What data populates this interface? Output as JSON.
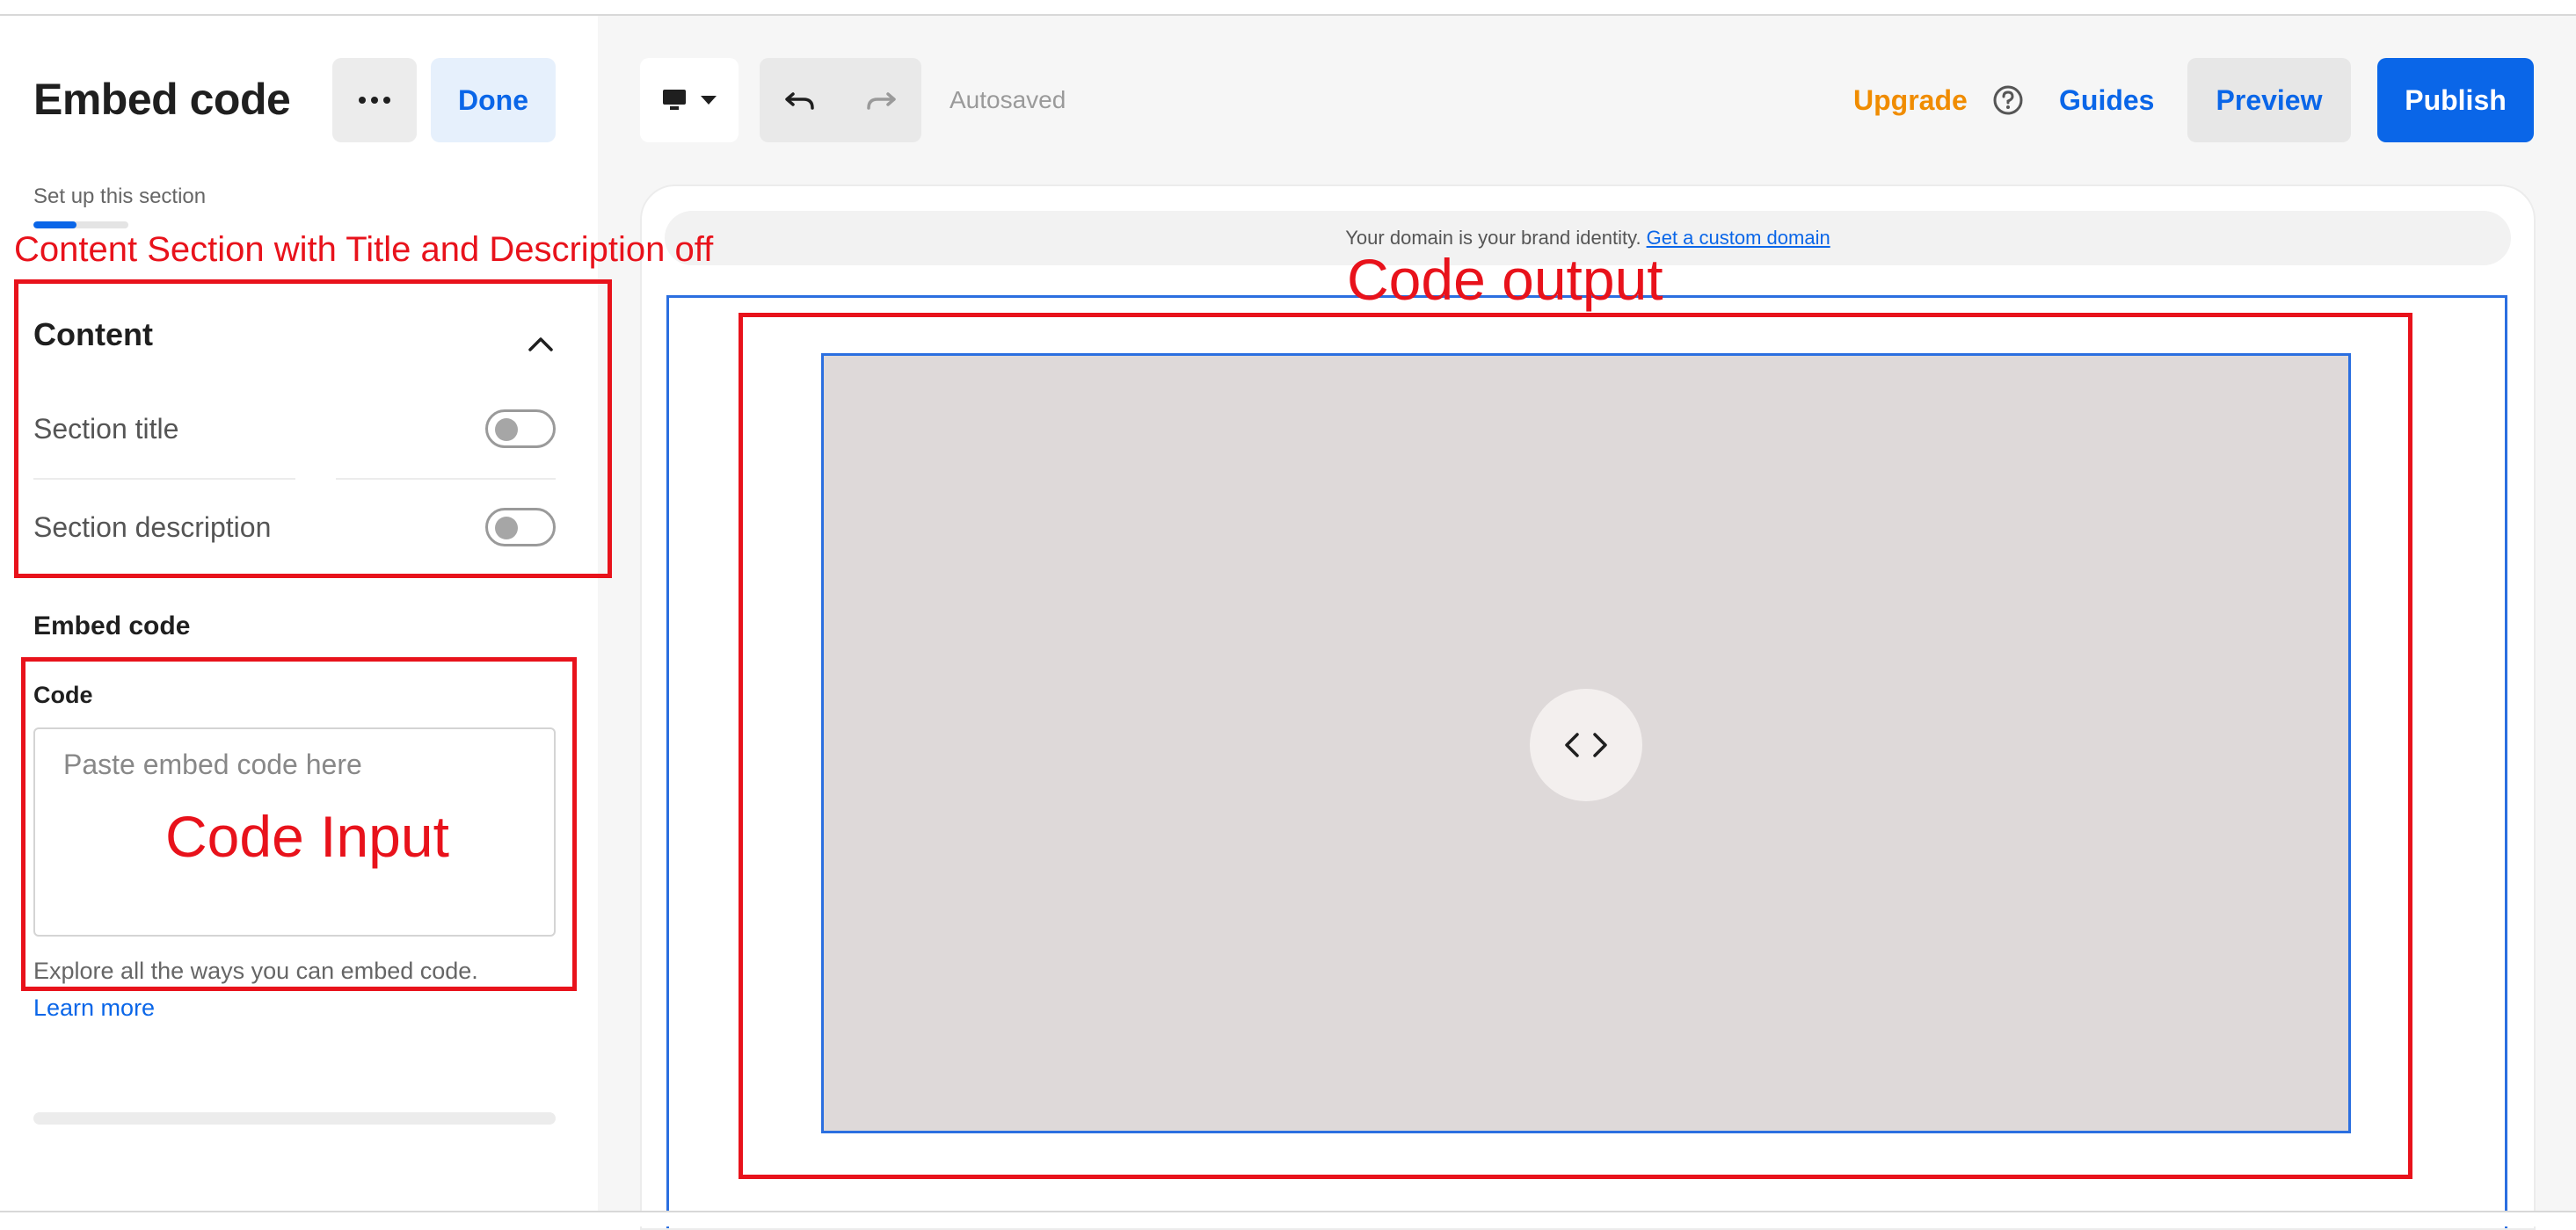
{
  "sidebar": {
    "title": "Embed code",
    "done_label": "Done",
    "more_icon": "more-horizontal-icon",
    "setup_label": "Set up this section",
    "progress_fraction": 0.45,
    "content_heading": "Content",
    "section_title_label": "Section title",
    "section_description_label": "Section description",
    "section_title_toggle": false,
    "section_description_toggle": false,
    "embed_heading": "Embed code",
    "code_label": "Code",
    "code_placeholder": "Paste embed code here",
    "help_text": "Explore all the ways you can embed code.",
    "learn_more": "Learn more"
  },
  "toolbar": {
    "device_icon": "desktop-icon",
    "undo_icon": "undo-icon",
    "redo_icon": "redo-icon",
    "autosaved": "Autosaved",
    "upgrade": "Upgrade",
    "help_icon": "help-circle-icon",
    "guides": "Guides",
    "preview": "Preview",
    "publish": "Publish"
  },
  "canvas": {
    "banner_text": "Your domain is your brand identity.",
    "banner_link": "Get a custom domain",
    "embed_icon": "code-brackets-icon"
  },
  "annotations": {
    "content_section": "Content Section with Title and Description off",
    "code_output": "Code output",
    "code_input": "Code Input"
  },
  "colors": {
    "accent": "#0a66e8",
    "upgrade": "#f08c00",
    "annotation": "#e8121b",
    "placeholder_bg": "#ded9d9"
  }
}
